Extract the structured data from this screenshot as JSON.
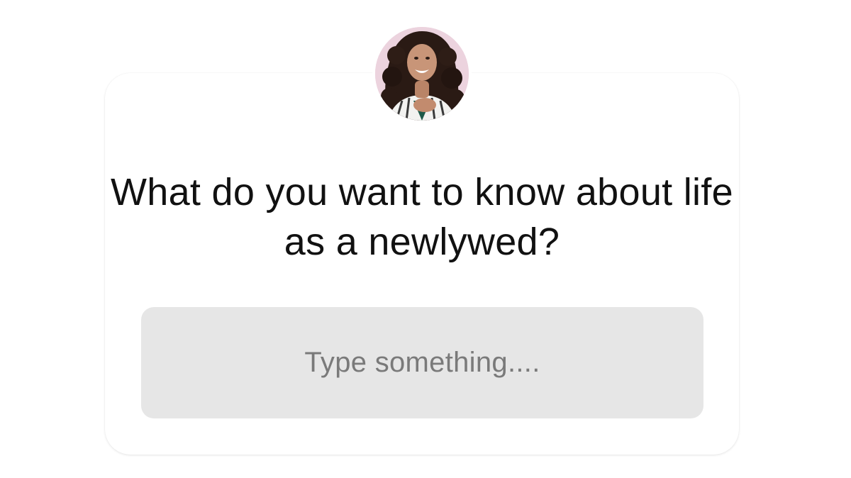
{
  "question_sticker": {
    "question": "What do you want to know about life as a newlywed?",
    "placeholder": "Type something....",
    "avatar_icon": "profile-photo",
    "colors": {
      "card_background": "#ffffff",
      "field_background": "#e6e6e6",
      "question_text": "#111111",
      "placeholder_text": "#7a7a7a",
      "avatar_background": "#ecd3de"
    }
  }
}
